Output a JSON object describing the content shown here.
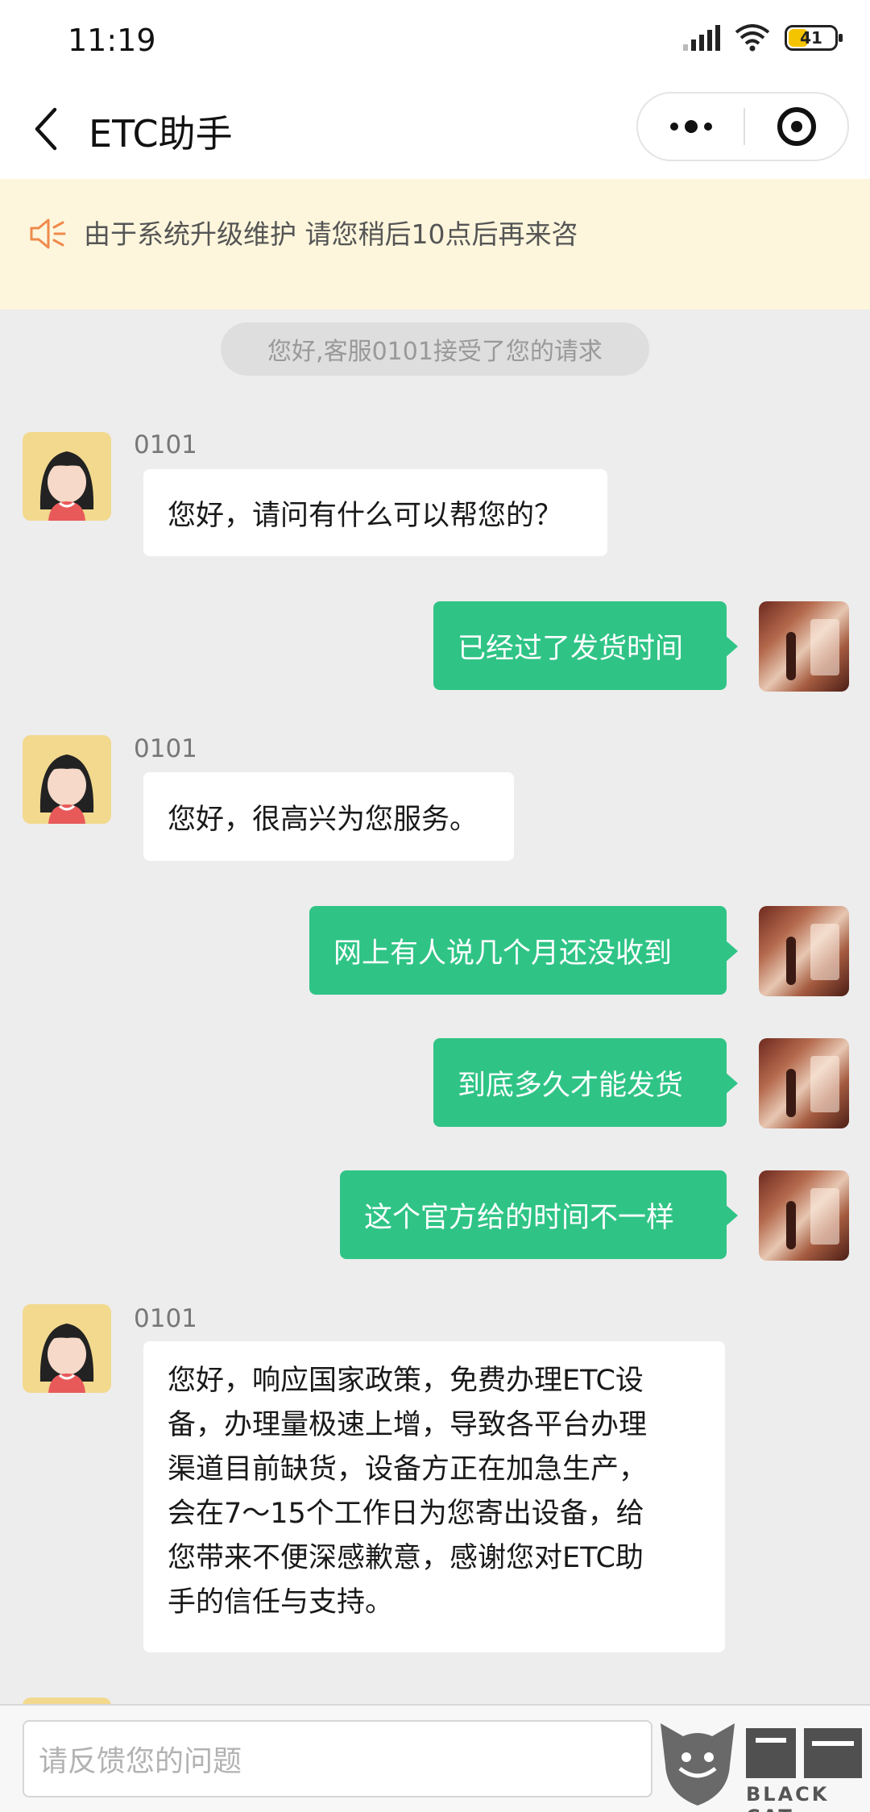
{
  "status_bar": {
    "time": "11:19",
    "battery": "41"
  },
  "nav": {
    "title": "ETC助手"
  },
  "notice": {
    "text": "由于系统升级维护 请您稍后10点后再来咨"
  },
  "system_tip": "您好,客服0101接受了您的请求",
  "messages": [
    {
      "from": "agent",
      "name": "0101",
      "text": "您好，请问有什么可以帮您的？"
    },
    {
      "from": "user",
      "text": "已经过了发货时间"
    },
    {
      "from": "agent",
      "name": "0101",
      "text": "您好，很高兴为您服务。"
    },
    {
      "from": "user",
      "text": "网上有人说几个月还没收到"
    },
    {
      "from": "user",
      "text": "到底多久才能发货"
    },
    {
      "from": "user",
      "text": "这个官方给的时间不一样"
    },
    {
      "from": "agent",
      "name": "0101",
      "lines": [
        "您好，响应国家政策，免费办理ETC设",
        "备，办理量极速上增，导致各平台办理",
        "渠道目前缺货，设备方正在加急生产，",
        "会在7～15个工作日为您寄出设备，给",
        "您带来不便深感歉意，感谢您对ETC助",
        "手的信任与支持。"
      ]
    }
  ],
  "input": {
    "placeholder": "请反馈您的问题"
  },
  "watermark": {
    "text": "BLACK CAT"
  }
}
